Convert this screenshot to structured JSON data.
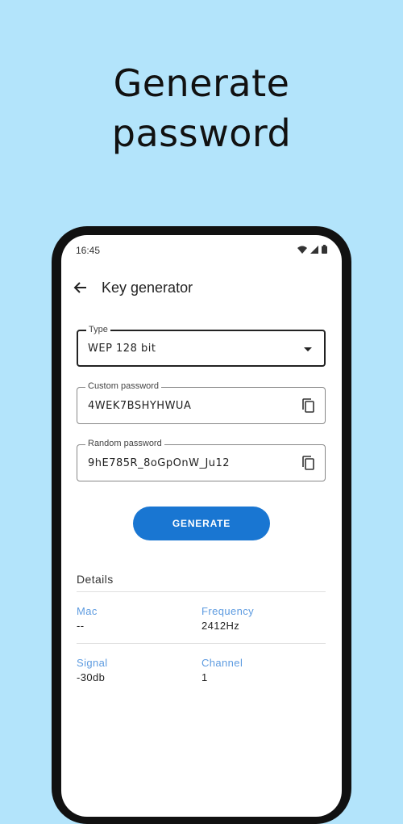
{
  "headline": {
    "line1": "Generate",
    "line2": "password"
  },
  "status_bar": {
    "time": "16:45"
  },
  "app_bar": {
    "title": "Key generator"
  },
  "type_field": {
    "label": "Type",
    "value": "WEP 128 bit"
  },
  "custom_field": {
    "label": "Custom password",
    "value": "4WEK7BSHYHWUA"
  },
  "random_field": {
    "label": "Random password",
    "value": "9hE785R_8oGpOnW_Ju12"
  },
  "generate_button": {
    "label": "GENERATE"
  },
  "details": {
    "title": "Details",
    "mac_label": "Mac",
    "mac_value": "--",
    "frequency_label": "Frequency",
    "frequency_value": "2412Hz",
    "signal_label": "Signal",
    "signal_value": "-30db",
    "channel_label": "Channel",
    "channel_value": "1"
  },
  "colors": {
    "background": "#b3e4fb",
    "accent": "#1976d2",
    "detail_label": "#5d9be0"
  }
}
